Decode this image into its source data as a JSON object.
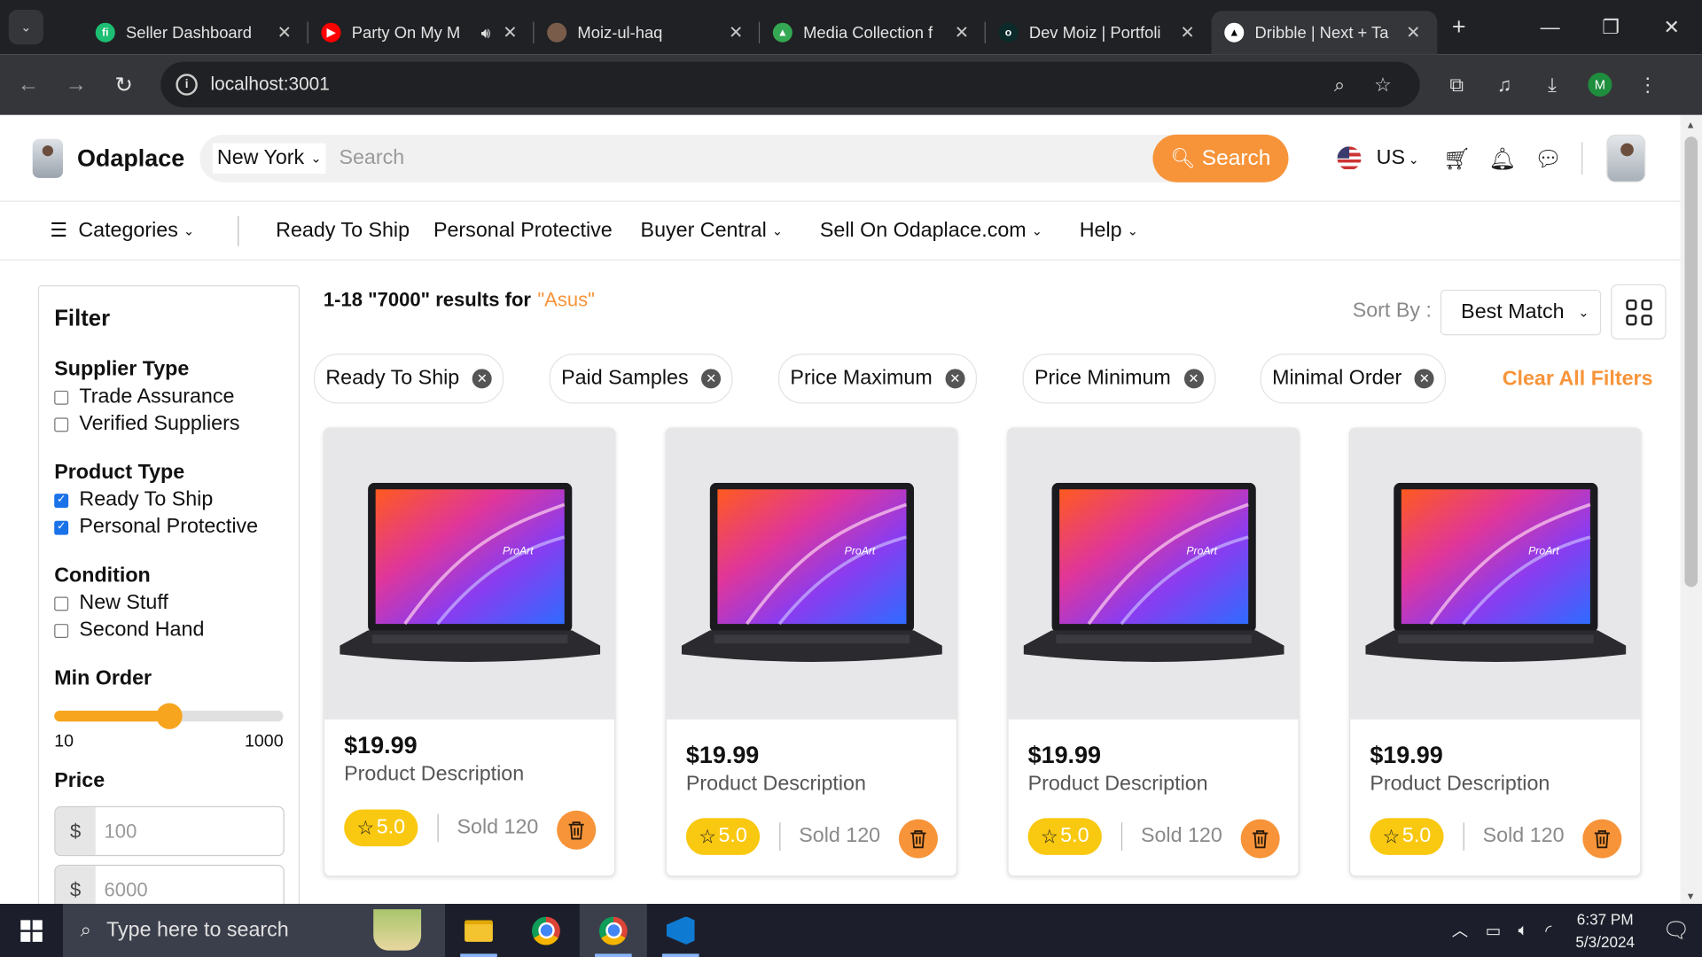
{
  "browser": {
    "tabs": [
      {
        "title": "Seller Dashboard",
        "favicon_color": "#1dbf73",
        "favicon_text": "fi"
      },
      {
        "title": "Party On My M",
        "favicon_color": "#ff0000",
        "favicon_text": "▶",
        "audio_icon": "speaker-icon"
      },
      {
        "title": "Moiz-ul-haq",
        "favicon_color": "#7a5c4a",
        "favicon_text": ""
      },
      {
        "title": "Media Collection f",
        "favicon_color": "#34a853",
        "favicon_text": "▲"
      },
      {
        "title": "Dev Moiz | Portfoli",
        "favicon_color": "#0b2b2b",
        "favicon_text": "o"
      },
      {
        "title": "Dribble | Next + Ta",
        "favicon_color": "#ffffff",
        "favicon_text": "▲",
        "active": true
      }
    ],
    "url": "localhost:3001",
    "profile_initial": "M"
  },
  "header": {
    "brand": "Odaplace",
    "location": "New York",
    "search_placeholder": "Search",
    "search_button": "Search",
    "country": "US",
    "accent_color": "#f7943a"
  },
  "nav": {
    "categories": "Categories",
    "links": [
      "Ready To Ship",
      "Personal Protective",
      "Buyer Central",
      "Sell On Odaplace.com",
      "Help"
    ]
  },
  "filter": {
    "title": "Filter",
    "supplier_type": {
      "label": "Supplier Type",
      "options": [
        {
          "label": "Trade Assurance",
          "checked": false
        },
        {
          "label": "Verified Suppliers",
          "checked": false
        }
      ]
    },
    "product_type": {
      "label": "Product Type",
      "options": [
        {
          "label": "Ready To Ship",
          "checked": true
        },
        {
          "label": "Personal Protective",
          "checked": true
        }
      ]
    },
    "condition": {
      "label": "Condition",
      "options": [
        {
          "label": "New Stuff",
          "checked": false
        },
        {
          "label": "Second Hand",
          "checked": false
        }
      ]
    },
    "min_order": {
      "label": "Min Order",
      "min": "10",
      "max": "1000",
      "slider_fraction": 0.5
    },
    "price": {
      "label": "Price",
      "currency": "$",
      "min_placeholder": "100",
      "max_placeholder": "6000"
    }
  },
  "results": {
    "summary": "1-18 \"7000\" results for",
    "query": "\"Asus\"",
    "sort_label": "Sort By :",
    "sort_value": "Best Match",
    "chips": [
      "Ready To Ship",
      "Paid Samples",
      "Price Maximum",
      "Price Minimum",
      "Minimal Order"
    ],
    "clear_all": "Clear All Filters"
  },
  "products": [
    {
      "price": "$19.99",
      "description": "Product Description",
      "rating": "5.0",
      "sold": "Sold 120"
    },
    {
      "price": "$19.99",
      "description": "Product Description",
      "rating": "5.0",
      "sold": "Sold 120"
    },
    {
      "price": "$19.99",
      "description": "Product Description",
      "rating": "5.0",
      "sold": "Sold 120"
    },
    {
      "price": "$19.99",
      "description": "Product Description",
      "rating": "5.0",
      "sold": "Sold 120"
    }
  ],
  "taskbar": {
    "search_placeholder": "Type here to search",
    "time": "6:37 PM",
    "date": "5/3/2024"
  }
}
